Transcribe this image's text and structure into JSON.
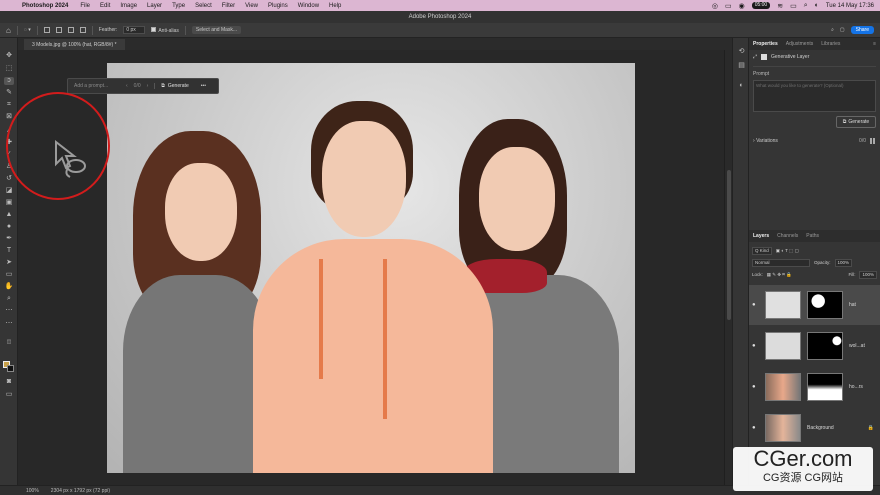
{
  "menubar": {
    "app": "Photoshop 2024",
    "items": [
      "File",
      "Edit",
      "Image",
      "Layer",
      "Type",
      "Select",
      "Filter",
      "View",
      "Plugins",
      "Window",
      "Help"
    ],
    "clock_badge": "05:00",
    "datetime": "Tue 14 May  17:36"
  },
  "window": {
    "title": "Adobe Photoshop 2024"
  },
  "options": {
    "feather_label": "Feather:",
    "feather_value": "0 px",
    "antialias_label": "Anti-alias",
    "select_mask_label": "Select and Mask...",
    "share_label": "Share"
  },
  "document": {
    "tab_title": "3 Models.jpg @ 100% (hat, RGB/8#) *",
    "tab_close": "×"
  },
  "taskbar": {
    "prompt_placeholder": "Add a prompt...",
    "counter": "0/0",
    "generate_label": "Generate",
    "more": "•••"
  },
  "properties": {
    "tabs": [
      "Properties",
      "Adjustments",
      "Libraries"
    ],
    "menu": "≡",
    "layer_type": "Generative Layer",
    "prompt_label": "Prompt",
    "prompt_placeholder": "What would you like to generate? (Optional)",
    "generate_label": "Generate",
    "variations_label": "Variations",
    "variations_count": "0/0"
  },
  "layers_panel": {
    "tabs": [
      "Layers",
      "Channels",
      "Paths"
    ],
    "filter_label": "Q Kind",
    "blend_mode": "Normal",
    "opacity_label": "Opacity:",
    "opacity_value": "100%",
    "lock_label": "Lock:",
    "fill_label": "Fill:",
    "fill_value": "100%",
    "layers": [
      {
        "name": "hat",
        "selected": true
      },
      {
        "name": "wol...at",
        "selected": false
      },
      {
        "name": "ho...rs",
        "selected": false
      },
      {
        "name": "Background",
        "selected": false
      }
    ]
  },
  "status": {
    "zoom": "100%",
    "doc_size": "2304 px x 1792 px (72 ppi)"
  },
  "watermark": {
    "big": "CGer.com",
    "small": "CG资源 CG网站"
  },
  "colors": {
    "foreground": "#c9a24a",
    "background": "#111111",
    "accent": "#1473e6",
    "highlight": "#d21c1c"
  }
}
